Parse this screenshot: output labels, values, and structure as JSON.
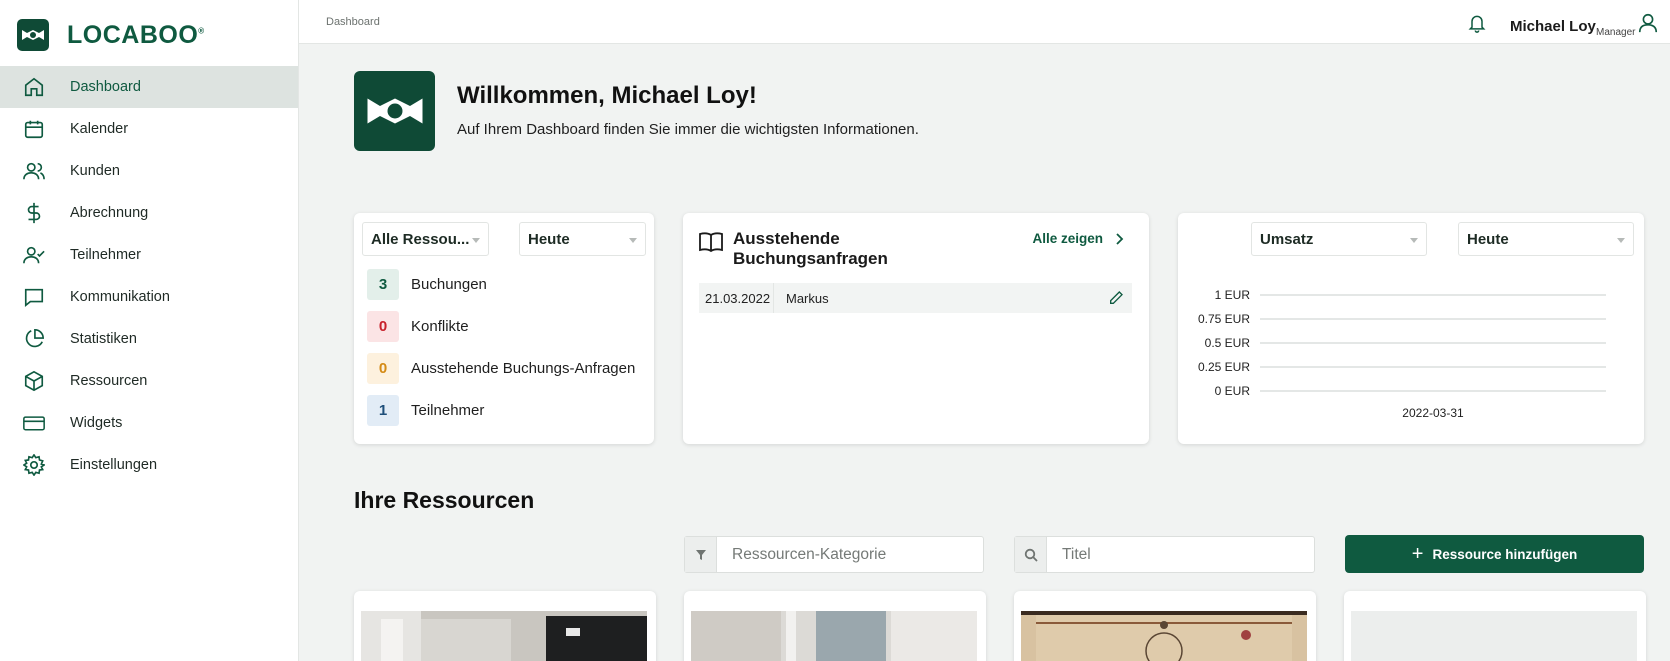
{
  "app": {
    "brand": "LOCABOO",
    "trademark": "®"
  },
  "sidebar": {
    "items": [
      {
        "label": "Dashboard",
        "icon": "home-icon",
        "active": true
      },
      {
        "label": "Kalender",
        "icon": "calendar-icon"
      },
      {
        "label": "Kunden",
        "icon": "users-icon"
      },
      {
        "label": "Abrechnung",
        "icon": "dollar-icon"
      },
      {
        "label": "Teilnehmer",
        "icon": "user-check-icon"
      },
      {
        "label": "Kommunikation",
        "icon": "message-icon"
      },
      {
        "label": "Statistiken",
        "icon": "pie-chart-icon"
      },
      {
        "label": "Ressourcen",
        "icon": "box-icon"
      },
      {
        "label": "Widgets",
        "icon": "credit-card-icon"
      },
      {
        "label": "Einstellungen",
        "icon": "settings-icon"
      }
    ]
  },
  "topbar": {
    "breadcrumb": "Dashboard",
    "user_name": "Michael Loy",
    "user_role": "Manager"
  },
  "welcome": {
    "title": "Willkommen, Michael Loy!",
    "subtitle": "Auf Ihrem Dashboard finden Sie immer die wichtigsten Informationen."
  },
  "stats_card": {
    "resource_select": "Alle Ressou...",
    "period_select": "Heute",
    "rows": [
      {
        "value": "3",
        "label": "Buchungen",
        "color": "#0f5a40",
        "bg": "#e3efea"
      },
      {
        "value": "0",
        "label": "Konflikte",
        "color": "#c8202a",
        "bg": "#fbe4e5"
      },
      {
        "value": "0",
        "label": "Ausstehende Buchungs-Anfragen",
        "color": "#d48a14",
        "bg": "#fdf1de"
      },
      {
        "value": "1",
        "label": "Teilnehmer",
        "color": "#1f4f7a",
        "bg": "#e2ecf6"
      }
    ]
  },
  "requests_card": {
    "title": "Ausstehende Buchungsanfragen",
    "show_all": "Alle zeigen",
    "rows": [
      {
        "date": "21.03.2022",
        "name": "Markus"
      }
    ]
  },
  "revenue_card": {
    "metric_select": "Umsatz",
    "period_select": "Heute"
  },
  "chart_data": {
    "type": "line",
    "x": [
      "2022-03-31"
    ],
    "series": [
      {
        "values": [
          0
        ]
      }
    ],
    "yticks": [
      "1 EUR",
      "0.75 EUR",
      "0.5 EUR",
      "0.25 EUR",
      "0 EUR"
    ],
    "ylim": [
      0,
      1
    ],
    "title": "",
    "xlabel": "",
    "ylabel": "",
    "grid": true
  },
  "resources": {
    "title": "Ihre Ressourcen",
    "category_placeholder": "Ressourcen-Kategorie",
    "title_placeholder": "Titel",
    "add_label": "Ressource hinzufügen"
  },
  "colors": {
    "primary": "#0f5a40",
    "logo_bg": "#0f4a36"
  }
}
